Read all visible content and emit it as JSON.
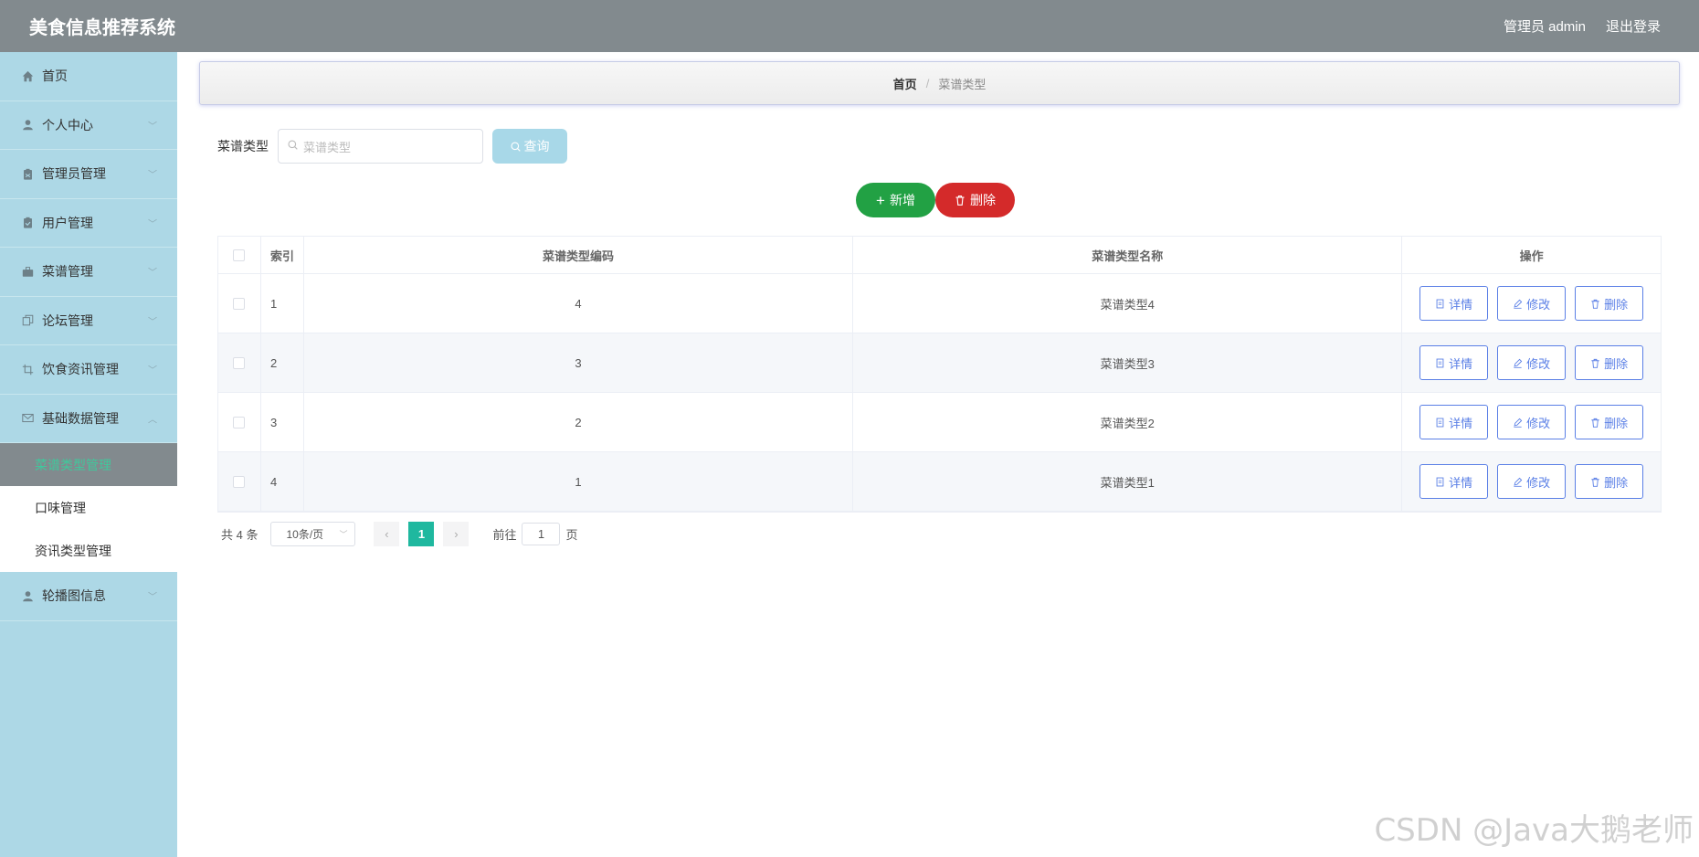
{
  "header": {
    "title": "美食信息推荐系统",
    "user": "管理员 admin",
    "logout": "退出登录"
  },
  "sidebar": {
    "items": [
      {
        "label": "首页",
        "icon": "home-icon",
        "arrow": false
      },
      {
        "label": "个人中心",
        "icon": "user-icon",
        "arrow": true
      },
      {
        "label": "管理员管理",
        "icon": "clipboard-icon",
        "arrow": true
      },
      {
        "label": "用户管理",
        "icon": "clipboard-check-icon",
        "arrow": true
      },
      {
        "label": "菜谱管理",
        "icon": "briefcase-icon",
        "arrow": true
      },
      {
        "label": "论坛管理",
        "icon": "copy-icon",
        "arrow": true
      },
      {
        "label": "饮食资讯管理",
        "icon": "crop-icon",
        "arrow": true
      },
      {
        "label": "基础数据管理",
        "icon": "mail-icon",
        "arrow": true,
        "expanded": true
      }
    ],
    "submenu": [
      {
        "label": "菜谱类型管理",
        "active": true
      },
      {
        "label": "口味管理",
        "active": false
      },
      {
        "label": "资讯类型管理",
        "active": false
      }
    ],
    "after": {
      "label": "轮播图信息",
      "icon": "user-icon",
      "arrow": true
    }
  },
  "breadcrumb": {
    "home": "首页",
    "sep": "/",
    "current": "菜谱类型"
  },
  "search": {
    "label": "菜谱类型",
    "placeholder": "菜谱类型",
    "button": "查询"
  },
  "actions": {
    "add": "新增",
    "delete": "删除"
  },
  "table": {
    "headers": [
      "索引",
      "菜谱类型编码",
      "菜谱类型名称",
      "操作"
    ],
    "rows": [
      {
        "index": "1",
        "code": "4",
        "name": "菜谱类型4"
      },
      {
        "index": "2",
        "code": "3",
        "name": "菜谱类型3"
      },
      {
        "index": "3",
        "code": "2",
        "name": "菜谱类型2"
      },
      {
        "index": "4",
        "code": "1",
        "name": "菜谱类型1"
      }
    ],
    "ops": {
      "detail": "详情",
      "edit": "修改",
      "delete": "删除"
    }
  },
  "pagination": {
    "total": "共 4 条",
    "size": "10条/页",
    "page": "1",
    "goto": "前往",
    "goto_value": "1",
    "page_unit": "页"
  },
  "watermark": "CSDN @Java大鹅老师",
  "colors": {
    "header": "#828a8e",
    "sidebar": "#add8e6",
    "add": "#22a144",
    "delete": "#d42a2a",
    "active_text": "#3fc99c",
    "op_border": "#5a7fe6",
    "pager_active": "#1fb89f"
  }
}
